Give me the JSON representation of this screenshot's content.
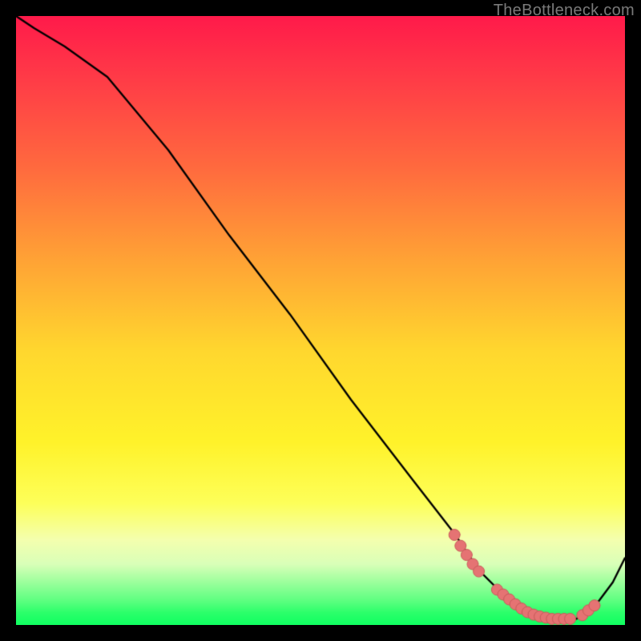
{
  "watermark": "TheBottleneck.com",
  "colors": {
    "page_bg": "#000000",
    "curve": "#000000",
    "marker_fill": "#e57373",
    "marker_stroke": "#c85a5a"
  },
  "chart_data": {
    "type": "line",
    "title": "",
    "xlabel": "",
    "ylabel": "",
    "xlim": [
      0,
      100
    ],
    "ylim": [
      0,
      100
    ],
    "grid": false,
    "legend": false,
    "annotations": [],
    "series": [
      {
        "name": "curve",
        "x": [
          0,
          3,
          8,
          15,
          25,
          35,
          45,
          55,
          65,
          72,
          76,
          80,
          84,
          88,
          92,
          95,
          98,
          100
        ],
        "y": [
          100,
          98,
          95,
          90,
          78,
          64,
          51,
          37,
          24,
          15,
          9,
          5,
          2,
          1,
          1,
          3,
          7,
          11
        ]
      }
    ],
    "markers": [
      {
        "x": 72.0,
        "y": 14.8
      },
      {
        "x": 73.0,
        "y": 13.0
      },
      {
        "x": 74.0,
        "y": 11.5
      },
      {
        "x": 75.0,
        "y": 10.0
      },
      {
        "x": 76.0,
        "y": 8.8
      },
      {
        "x": 79.0,
        "y": 5.8
      },
      {
        "x": 80.0,
        "y": 5.0
      },
      {
        "x": 81.0,
        "y": 4.2
      },
      {
        "x": 82.0,
        "y": 3.4
      },
      {
        "x": 83.0,
        "y": 2.7
      },
      {
        "x": 84.0,
        "y": 2.1
      },
      {
        "x": 85.0,
        "y": 1.7
      },
      {
        "x": 86.0,
        "y": 1.4
      },
      {
        "x": 87.0,
        "y": 1.2
      },
      {
        "x": 88.0,
        "y": 1.0
      },
      {
        "x": 89.0,
        "y": 1.0
      },
      {
        "x": 90.0,
        "y": 1.0
      },
      {
        "x": 91.0,
        "y": 1.0
      },
      {
        "x": 93.0,
        "y": 1.6
      },
      {
        "x": 94.0,
        "y": 2.4
      },
      {
        "x": 95.0,
        "y": 3.2
      }
    ],
    "marker_radius_px": 7
  }
}
